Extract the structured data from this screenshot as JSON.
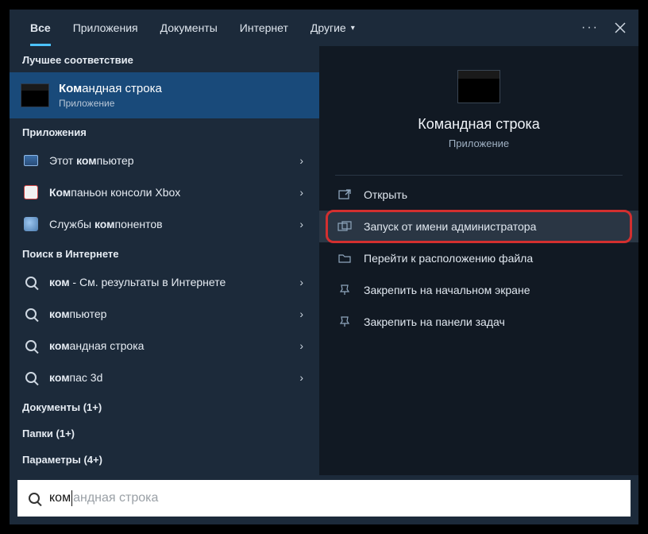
{
  "tabs": {
    "all": "Все",
    "apps": "Приложения",
    "docs": "Документы",
    "web": "Интернет",
    "more": "Другие"
  },
  "sections": {
    "best": "Лучшее соответствие",
    "apps": "Приложения",
    "web": "Поиск в Интернете",
    "docs": "Документы (1+)",
    "folders": "Папки (1+)",
    "settings": "Параметры (4+)"
  },
  "best": {
    "title_pre": "Ком",
    "title_post": "андная строка",
    "subtitle": "Приложение"
  },
  "apps": [
    {
      "pre": "Этот ",
      "hl": "ком",
      "post": "пьютер"
    },
    {
      "pre": "",
      "hl": "Ком",
      "post": "паньон консоли Xbox"
    },
    {
      "pre": "Службы ",
      "hl": "ком",
      "post": "понентов"
    }
  ],
  "web": [
    {
      "hl": "ком",
      "post": " - См. результаты в Интернете"
    },
    {
      "hl": "ком",
      "post": "пьютер"
    },
    {
      "hl": "ком",
      "post": "андная строка"
    },
    {
      "hl": "ком",
      "post": "пас 3d"
    }
  ],
  "preview": {
    "title": "Командная строка",
    "subtitle": "Приложение"
  },
  "actions": {
    "open": "Открыть",
    "runadmin": "Запуск от имени администратора",
    "openloc": "Перейти к расположению файла",
    "pinstart": "Закрепить на начальном экране",
    "pintask": "Закрепить на панели задач"
  },
  "search": {
    "typed": "ком",
    "ghost": "андная строка"
  }
}
